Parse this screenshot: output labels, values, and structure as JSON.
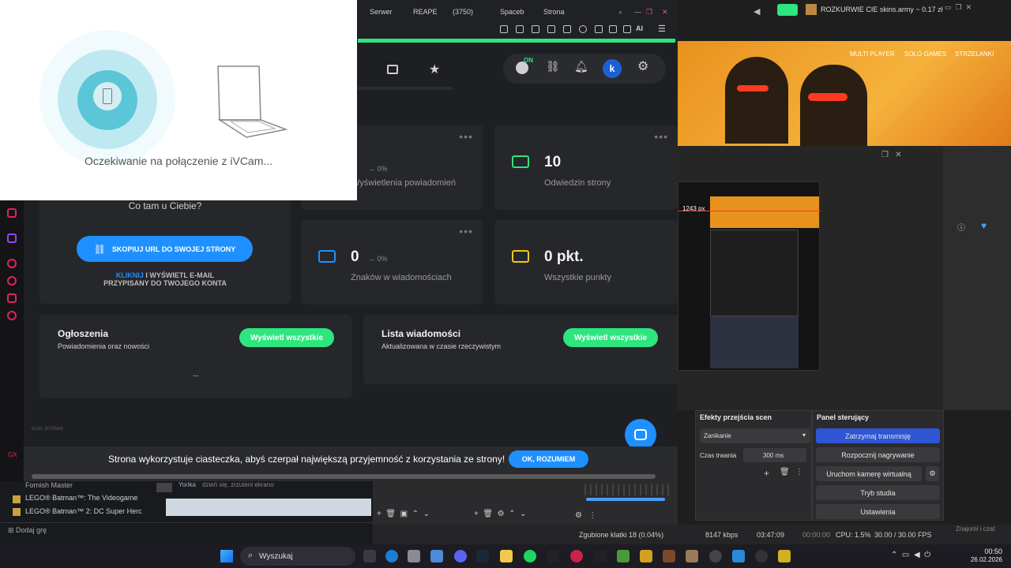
{
  "browser": {
    "tabs": [
      "Serwer",
      "REAPE",
      "(3750)",
      "Spaceb",
      "Strona"
    ],
    "ai_label": "AI"
  },
  "dashboard": {
    "theme_badge": "ON",
    "avatar_letter": "k",
    "profile_card": {
      "greeting": "Co tam u Ciebie?",
      "copy_button": "SKOPIUJ URL DO SWOJEJ STRONY",
      "email_link": "KLIKNIJ",
      "email_text_1": "I WYŚWIETL E-MAIL",
      "email_text_2": "PRZYPISANY DO TWOJEGO KONTA"
    },
    "stats": [
      {
        "value": "",
        "delta": "→ 0%",
        "label": "Wyświetlenia powiadomień"
      },
      {
        "value": "10",
        "delta": "",
        "label": "Odwiedzin strony"
      },
      {
        "value": "0",
        "delta": "→ 0%",
        "label": "Znaków w wiadomościach"
      },
      {
        "value": "0 pkt.",
        "delta": "",
        "label": "Wszystkie punkty"
      }
    ],
    "announcements": {
      "title": "Ogłoszenia",
      "subtitle": "Powiadomienia oraz nowości",
      "button": "Wyświetl wszystkie",
      "content": "..."
    },
    "messages": {
      "title": "Lista wiadomości",
      "subtitle": "Aktualizowana w czasie rzeczywistym",
      "button": "Wyświetl wszystkie"
    },
    "build": "Build: 9cf9f6e8",
    "cookie_text": "Strona wykorzystuje ciasteczka, abyś czerpał największą przyjemność z korzystania ze strony!",
    "cookie_button": "OK, ROZUMIEM"
  },
  "ivcam": {
    "status": "Oczekiwanie na połączenie z iVCam..."
  },
  "stream": {
    "alert": "ROZKURWIE CIE skins.army ~ 0.17 zł",
    "tags": [
      "MULTI PLAYER",
      "SOLO GAMES",
      "STRZELANKI"
    ],
    "preview_px": "1243 px"
  },
  "obs": {
    "transitions_title": "Efekty przejścia scen",
    "transition": "Zanikanie",
    "duration_label": "Czas trwania",
    "duration_value": "300 ms",
    "controls_title": "Panel sterujący",
    "buttons": [
      "Zatrzymaj transmisję",
      "Rozpocznij nagrywanie",
      "Uruchom kamerę wirtualną",
      "Tryb studia",
      "Ustawienia"
    ],
    "status": {
      "dropped": "Zgubione klatki 18 (0.04%)",
      "bitrate": "8147 kbps",
      "stream_time": "03:47:09",
      "rec_time": "00:00:00",
      "cpu": "CPU: 1.5%",
      "fps": "30.00 / 30.00 FPS"
    },
    "friends": "Znajomi i czat"
  },
  "games": {
    "items": [
      "Fornish Master",
      "LEGO® Batman™: The Videogame",
      "LEGO® Batman™ 2: DC Super Herc"
    ],
    "add_game": "Dodaj grę",
    "chat_user": "Yorika",
    "chat_text": "dzień się, zrzuteni ekrano"
  },
  "taskbar": {
    "search": "Wyszukaj",
    "time": "00:50",
    "date": "26.02.2026"
  },
  "colors": {
    "accent": "#2ee57f",
    "blue": "#1e90ff",
    "yellow": "#f5c518",
    "obs_blue": "#2f55d4"
  }
}
